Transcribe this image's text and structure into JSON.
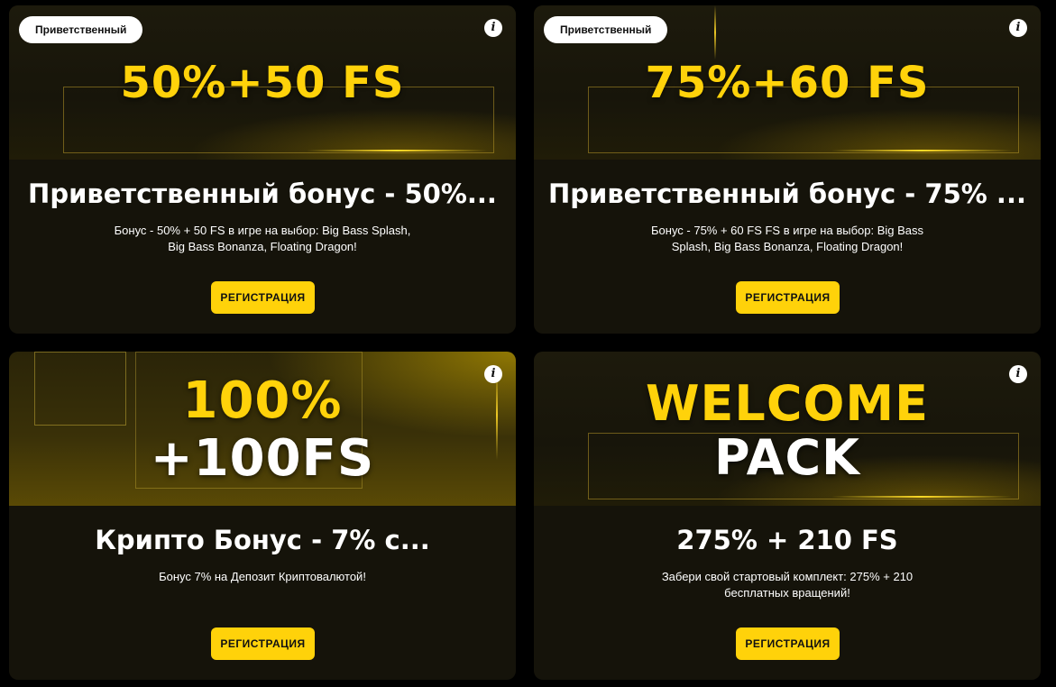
{
  "cards": [
    {
      "badge": "Приветственный",
      "info_icon": "info-icon",
      "banner_line1": "50%+50 FS",
      "title": "Приветственный бонус - 50%...",
      "description": "Бонус - 50% + 50 FS в игре на выбор: Big Bass Splash, Big Bass Bonanza, Floating Dragon!",
      "button": "РЕГИСТРАЦИЯ"
    },
    {
      "badge": "Приветственный",
      "info_icon": "info-icon",
      "banner_line1": "75%+60 FS",
      "title": "Приветственный бонус - 75% ...",
      "description": "Бонус - 75% + 60 FS FS в игре на выбор: Big Bass Splash, Big Bass Bonanza, Floating Dragon!",
      "button": "РЕГИСТРАЦИЯ"
    },
    {
      "info_icon": "info-icon",
      "banner_line1": "100%",
      "banner_line2": "+100FS",
      "title": "Крипто Бонус - 7% с...",
      "description": "Бонус 7% на Депозит Криптовалютой!",
      "button": "РЕГИСТРАЦИЯ"
    },
    {
      "info_icon": "info-icon",
      "banner_line1": "WELCOME",
      "banner_line2": "PACK",
      "title": "275% + 210 FS",
      "description": "Забери свой стартовый комплект: 275% + 210 бесплатных вращений!",
      "button": "РЕГИСТРАЦИЯ"
    }
  ],
  "colors": {
    "accent": "#ffd20a",
    "card_bg": "#15130a",
    "page_bg": "#000000"
  }
}
